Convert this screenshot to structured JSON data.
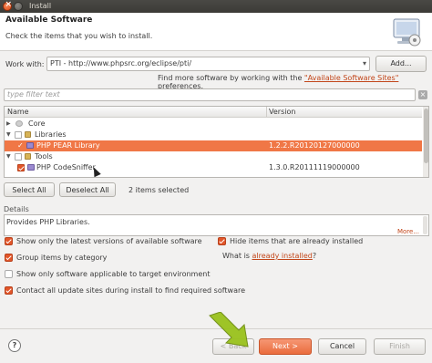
{
  "window": {
    "title": "Install"
  },
  "header": {
    "title": "Available Software",
    "description": "Check the items that you wish to install."
  },
  "work_with": {
    "label": "Work with:",
    "value": "PTI - http://www.phpsrc.org/eclipse/pti/",
    "add_label": "Add...",
    "find_more_prefix": "Find more software by working with the ",
    "find_more_link": "\"Available Software Sites\"",
    "find_more_suffix": " preferences."
  },
  "filter": {
    "placeholder": "type filter text"
  },
  "tree": {
    "columns": [
      "Name",
      "Version"
    ],
    "rows": [
      {
        "name": "Core",
        "version": "",
        "expanded": false,
        "checked": false,
        "selected": false
      },
      {
        "name": "Libraries",
        "version": "",
        "expanded": true,
        "checked": false,
        "selected": false
      },
      {
        "name": "PHP PEAR Library",
        "version": "1.2.2.R20120127000000",
        "checked": true,
        "selected": true
      },
      {
        "name": "Tools",
        "version": "",
        "expanded": true,
        "checked": false,
        "selected": false
      },
      {
        "name": "PHP CodeSniffer",
        "version": "1.3.0.R20111119000000",
        "checked": true,
        "selected": false
      }
    ]
  },
  "selection": {
    "select_all": "Select All",
    "deselect_all": "Deselect All",
    "count_text": "2 items selected"
  },
  "details": {
    "label": "Details",
    "text": "Provides PHP Libraries.",
    "more": "More..."
  },
  "options": {
    "latest_versions": {
      "label": "Show only the latest versions of available software",
      "checked": true
    },
    "group_by_category": {
      "label": "Group items by category",
      "checked": true
    },
    "applicable_only": {
      "label": "Show only software applicable to target environment",
      "checked": false
    },
    "contact_all_sites": {
      "label": "Contact all update sites during install to find required software",
      "checked": true
    },
    "hide_installed": {
      "label": "Hide items that are already installed",
      "checked": true
    },
    "what_installed_prefix": "What is ",
    "what_installed_link": "already installed",
    "what_installed_suffix": "?"
  },
  "buttons": {
    "help": "?",
    "back": "< Back",
    "next": "Next >",
    "cancel": "Cancel",
    "finish": "Finish"
  },
  "colors": {
    "accent": "#f07746",
    "link": "#c2461a",
    "annotation_arrow": "#9ac21d"
  }
}
